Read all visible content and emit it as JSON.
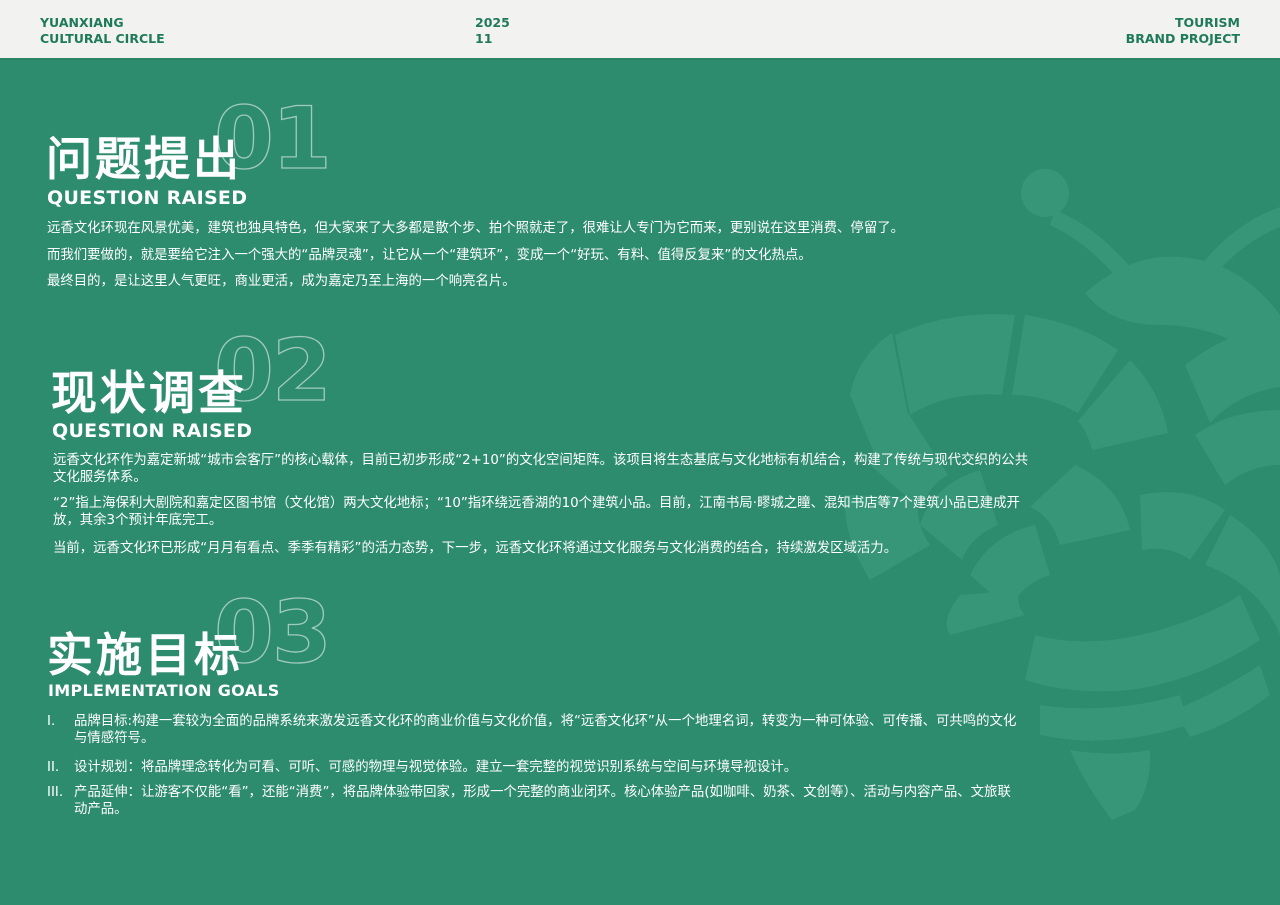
{
  "header": {
    "left": [
      "YUANXIANG",
      "CULTURAL CIRCLE"
    ],
    "middle": [
      "2025",
      "11"
    ],
    "right": [
      "TOURISM",
      "BRAND PROJECT"
    ]
  },
  "sections": [
    {
      "number": "01",
      "title_zh": "问题提出",
      "title_en": "QUESTION RAISED",
      "paragraphs": [
        "远香文化环现在风景优美，建筑也独具特色，但大家来了大多都是散个步、拍个照就走了，很难让人专门为它而来，更别说在这里消费、停留了。",
        "而我们要做的，就是要给它注入一个强大的“品牌灵魂”，让它从一个“建筑环”，变成一个“好玩、有料、值得反复来”的文化热点。",
        "最终目的，是让这里人气更旺，商业更活，成为嘉定乃至上海的一个响亮名片。"
      ]
    },
    {
      "number": "02",
      "title_zh": "现状调查",
      "title_en": "QUESTION RAISED",
      "paragraphs": [
        "远香文化环作为嘉定新城“城市会客厅”的核心载体，目前已初步形成“2+10”的文化空间矩阵。该项目将生态基底与文化地标有机结合，构建了传统与现代交织的公共文化服务体系。",
        "“2”指上海保利大剧院和嘉定区图书馆（文化馆）两大文化地标；“10”指环绕远香湖的10个建筑小品。目前，江南书局·疁城之瞳、混知书店等7个建筑小品已建成开放，其余3个预计年底完工。",
        "当前，远香文化环已形成“月月有看点、季季有精彩”的活力态势，下一步，远香文化环将通过文化服务与文化消费的结合，持续激发区域活力。"
      ]
    },
    {
      "number": "03",
      "title_zh": "实施目标",
      "title_en": "IMPLEMENTATION GOALS",
      "goals": [
        {
          "index": "I.",
          "text": "品牌目标:构建一套较为全面的品牌系统来激发远香文化环的商业价值与文化价值，将“远香文化环”从一个地理名词，转变为一种可体验、可传播、可共鸣的文化与情感符号。"
        },
        {
          "index": "II.",
          "text": "设计规划：将品牌理念转化为可看、可听、可感的物理与视觉体验。建立一套完整的视觉识别系统与空间与环境导视设计。"
        },
        {
          "index": "III.",
          "text": "产品延伸：让游客不仅能“看”，还能“消费”，将品牌体验带回家，形成一个完整的商业闭环。核心体验产品(如咖啡、奶茶、文创等）、活动与内容产品、文旅联动产品。"
        }
      ]
    }
  ],
  "colors": {
    "background": "#2d8b6e",
    "header_bg": "#f2f2f0",
    "header_text": "#1f7a5c",
    "emblem": "#3a9a7b"
  },
  "icons": {
    "emblem": "logo-emblem-icon"
  }
}
